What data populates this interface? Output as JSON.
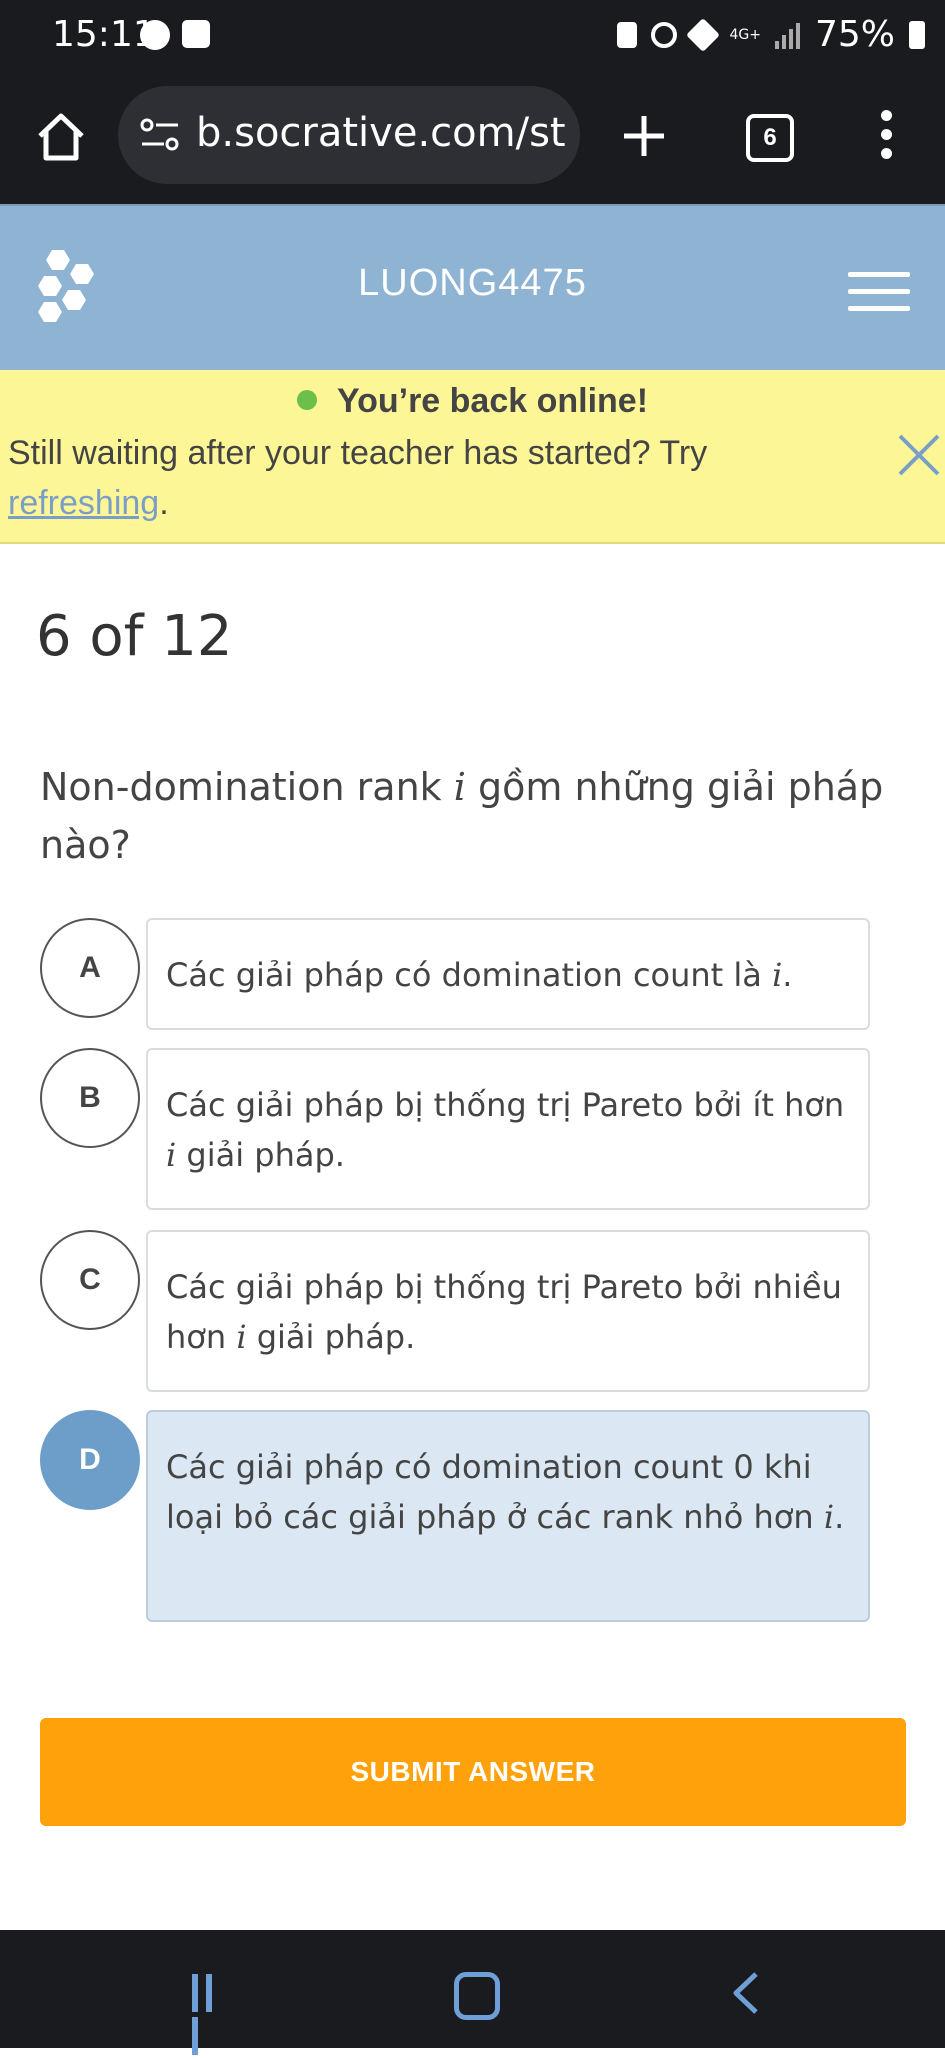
{
  "status_bar": {
    "time": "15:11",
    "network": "4G+",
    "battery": "75%",
    "icons": [
      "messenger-icon",
      "gallery-icon",
      "lock-icon",
      "alarm-icon",
      "mute-icon",
      "signal-icon",
      "battery-icon"
    ]
  },
  "browser": {
    "url": "b.socrative.com/st",
    "tab_count": "6"
  },
  "app": {
    "room_name": "LUONG4475"
  },
  "banner": {
    "title": "You’re back online!",
    "text": "Still waiting after your teacher has started? Try",
    "link": "refreshing",
    "suffix": "."
  },
  "quiz": {
    "progress": "6 of 12",
    "question_pre": "Non-domination rank",
    "question_var": "i",
    "question_post": "gồm những giải pháp nào?",
    "options": [
      {
        "letter": "A",
        "pre": "Các giải pháp có domination count là",
        "var": "i",
        "post": ".",
        "selected": false
      },
      {
        "letter": "B",
        "pre": "Các giải pháp bị thống trị Pareto bởi ít hơn",
        "var": "i",
        "post": "giải pháp.",
        "selected": false
      },
      {
        "letter": "C",
        "pre": "Các giải pháp bị thống trị Pareto bởi nhiều hơn",
        "var": "i",
        "post": "giải pháp.",
        "selected": false
      },
      {
        "letter": "D",
        "pre": "Các giải pháp có domination count 0 khi loại bỏ các giải pháp ở các rank nhỏ hơn",
        "var": "i",
        "post": ".",
        "selected": true
      }
    ],
    "submit_label": "SUBMIT ANSWER"
  },
  "colors": {
    "header_bg": "#8eb3d3",
    "banner_bg": "#fdf697",
    "selected_circle": "#6d9dc9",
    "selected_box": "#dbe8f3",
    "submit_bg": "#ffa10a",
    "online_dot": "#6cc04a"
  }
}
